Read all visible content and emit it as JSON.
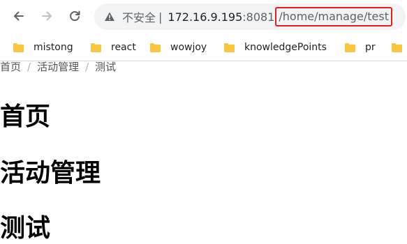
{
  "browser": {
    "security_label": "不安全",
    "separator": "|",
    "url_host": "172.16.9.195",
    "url_port": ":8081",
    "url_path": "/home/manage/test"
  },
  "bookmarks": [
    {
      "label": "mistong"
    },
    {
      "label": "react"
    },
    {
      "label": "wowjoy"
    },
    {
      "label": "knowledgePoints"
    },
    {
      "label": "pr"
    }
  ],
  "breadcrumb": [
    "首页",
    "活动管理",
    "测试"
  ],
  "headings": [
    "首页",
    "活动管理",
    "测试"
  ],
  "colors": {
    "url_highlight_border": "#e02020",
    "folder_icon": "#f6c644"
  }
}
